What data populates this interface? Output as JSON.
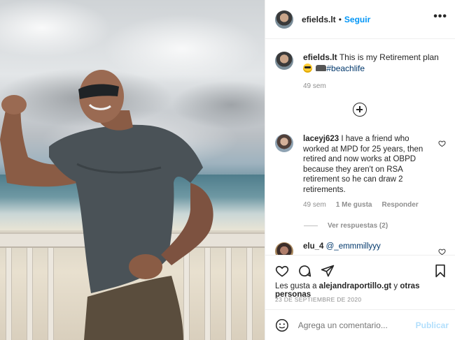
{
  "post": {
    "author": "efields.lt",
    "follow_label": "Seguir",
    "separator": "•",
    "more_label": "•••"
  },
  "caption": {
    "user": "efields.lt",
    "text": "This is my Retirement plan",
    "hashtag": "#beachlife",
    "time": "49 sem"
  },
  "comments": [
    {
      "user": "laceyj623",
      "text": "I have a friend who worked at MPD for 25 years, then retired and now works at OBPD because they aren't on RSA retirement so he can draw 2 retirements.",
      "time": "49 sem",
      "likes": "1 Me gusta",
      "reply_label": "Responder",
      "view_replies": "Ver respuestas (2)"
    },
    {
      "user": "elu_4",
      "text": "@_emmmillyyy"
    }
  ],
  "likes": {
    "prefix": "Les gusta a",
    "user": "alejandraportillo.gt",
    "middle": "y",
    "others": "otras personas"
  },
  "date": "23 DE SEPTIEMBRE DE 2020",
  "composer": {
    "placeholder": "Agrega un comentario...",
    "publish_label": "Publicar"
  },
  "icons": {
    "more": "more-options-icon",
    "add": "load-more-comments-icon",
    "like": "heart-icon",
    "comment": "comment-icon",
    "share": "share-icon",
    "save": "bookmark-icon",
    "emoji": "emoji-icon"
  }
}
